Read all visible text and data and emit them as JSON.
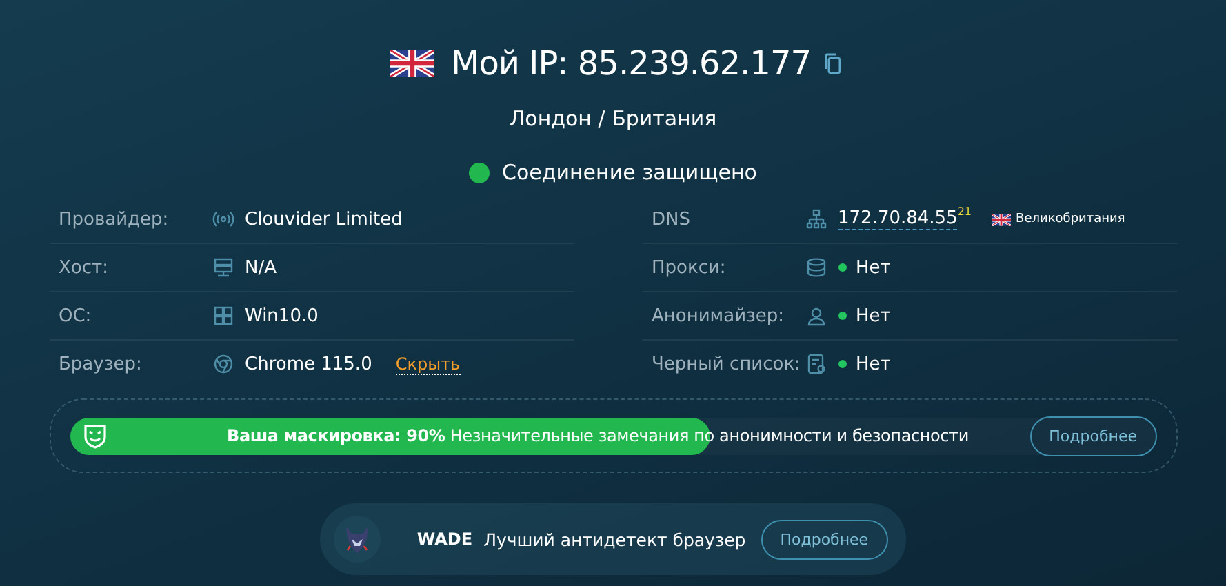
{
  "header": {
    "title": "Мой IP: 85.239.62.177",
    "location": "Лондон / Британия",
    "connection": {
      "text": "Соединение защищено",
      "secure": true
    }
  },
  "left_rows": [
    {
      "kind": "plain",
      "label": "Провайдер:",
      "value": "Clouvider Limited"
    },
    {
      "kind": "plain",
      "label": "Хост:",
      "value": "N/A"
    },
    {
      "kind": "plain",
      "label": "ОС:",
      "value": "Win10.0"
    },
    {
      "kind": "link",
      "label": "Браузер:",
      "value": "Chrome 115.0",
      "link": "Скрыть"
    }
  ],
  "right_rows": [
    {
      "kind": "dns",
      "label": "DNS",
      "value": "172.70.84.55",
      "count": "21",
      "country": "Великобритания"
    },
    {
      "kind": "status",
      "label": "Прокси:",
      "value": "Нет",
      "color": "#22c55e"
    },
    {
      "kind": "status",
      "label": "Анонимайзер:",
      "value": "Нет",
      "color": "#22c55e"
    },
    {
      "kind": "status",
      "label": "Черный список:",
      "value": "Нет",
      "color": "#22c55e"
    }
  ],
  "disguise": {
    "text": "**Ваша маскировка: 90%** Незначительные замечания по анонимности и безопасности",
    "level": 0.59,
    "button": "Подробнее"
  },
  "promo": {
    "brand": "WADE",
    "text": "Лучший антидетект браузер",
    "button": "Подробнее"
  }
}
